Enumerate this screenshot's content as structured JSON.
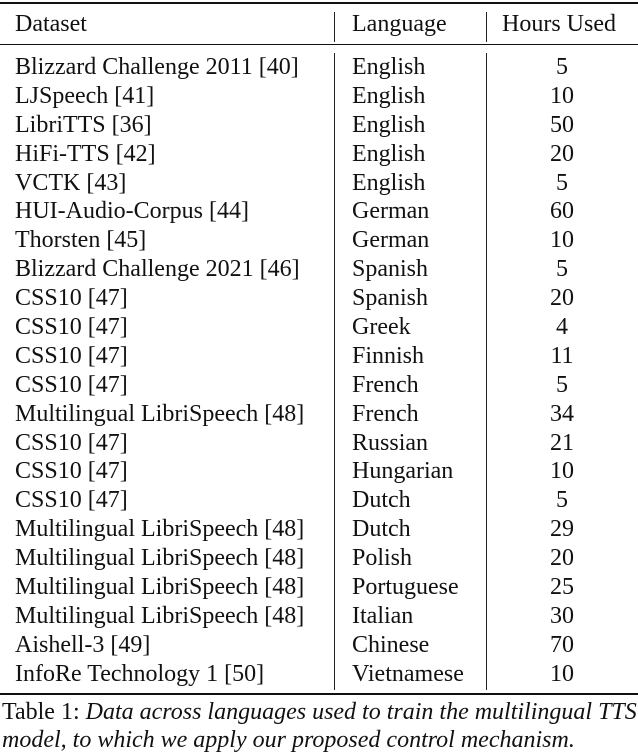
{
  "table": {
    "headers": [
      "Dataset",
      "Language",
      "Hours Used"
    ],
    "rows": [
      [
        "Blizzard Challenge 2011 [40]",
        "English",
        "5"
      ],
      [
        "LJSpeech [41]",
        "English",
        "10"
      ],
      [
        "LibriTTS [36]",
        "English",
        "50"
      ],
      [
        "HiFi-TTS [42]",
        "English",
        "20"
      ],
      [
        "VCTK [43]",
        "English",
        "5"
      ],
      [
        "HUI-Audio-Corpus [44]",
        "German",
        "60"
      ],
      [
        "Thorsten [45]",
        "German",
        "10"
      ],
      [
        "Blizzard Challenge 2021 [46]",
        "Spanish",
        "5"
      ],
      [
        "CSS10 [47]",
        "Spanish",
        "20"
      ],
      [
        "CSS10 [47]",
        "Greek",
        "4"
      ],
      [
        "CSS10 [47]",
        "Finnish",
        "11"
      ],
      [
        "CSS10 [47]",
        "French",
        "5"
      ],
      [
        "Multilingual LibriSpeech [48]",
        "French",
        "34"
      ],
      [
        "CSS10 [47]",
        "Russian",
        "21"
      ],
      [
        "CSS10 [47]",
        "Hungarian",
        "10"
      ],
      [
        "CSS10 [47]",
        "Dutch",
        "5"
      ],
      [
        "Multilingual LibriSpeech [48]",
        "Dutch",
        "29"
      ],
      [
        "Multilingual LibriSpeech [48]",
        "Polish",
        "20"
      ],
      [
        "Multilingual LibriSpeech [48]",
        "Portuguese",
        "25"
      ],
      [
        "Multilingual LibriSpeech [48]",
        "Italian",
        "30"
      ],
      [
        "Aishell-3 [49]",
        "Chinese",
        "70"
      ],
      [
        "InfoRe Technology 1 [50]",
        "Vietnamese",
        "10"
      ]
    ]
  },
  "caption": {
    "label": "Table 1: ",
    "text": "Data across languages used to train the multilingual TTS model, to which we apply our proposed control mechanism."
  }
}
